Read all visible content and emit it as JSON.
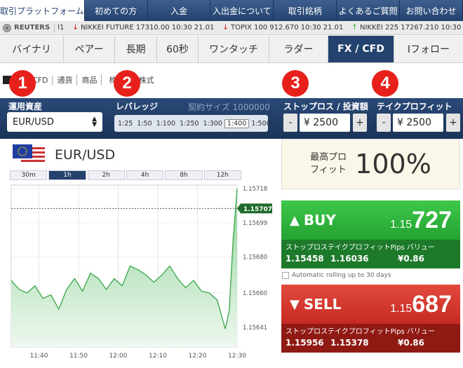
{
  "top_nav": [
    "取引プラットフォーム",
    "初めての方",
    "入金",
    "入出金について",
    "取引銘柄",
    "よくあるご質問",
    "お問い合わせ"
  ],
  "ticker": {
    "source": "REUTERS",
    "prefix": "l1",
    "items": [
      {
        "text": "NIKKEI FUTURE 17310.00 10:30 21.01",
        "dir": "down"
      },
      {
        "text": "TOPIX 100 912.670 10:30 21.01",
        "dir": "down"
      },
      {
        "text": "NIKKEI 225 17267.210 10:30",
        "dir": "up"
      }
    ]
  },
  "product_tabs": [
    "バイナリ",
    "ペアー",
    "長期",
    "60秒",
    "ワンタッチ",
    "ラダー",
    "FX / CFD",
    "Iフォロー"
  ],
  "sub_tabs": [
    "CFD",
    "通貨",
    "商品",
    "株",
    "株式"
  ],
  "badges": [
    "1",
    "2",
    "3",
    "4"
  ],
  "settings": {
    "asset_label": "運用資産",
    "asset_value": "EUR/USD",
    "leverage_label": "レバレッジ",
    "contract_label": "契約サイズ 1000000",
    "leverage_options": [
      "1:25",
      "1:50",
      "1:100",
      "1:250",
      "1:300",
      "1:400",
      "1:500"
    ],
    "leverage_selected": "1:400",
    "stoploss_label": "ストップロス / 投資額",
    "stoploss_value": "¥ 2500",
    "takeprofit_label": "テイクプロフィット",
    "takeprofit_value": "¥ 2500",
    "minus": "-",
    "plus": "+"
  },
  "chart_header": {
    "pair": "EUR/USD"
  },
  "timeframes": [
    "30m",
    "1h",
    "2h",
    "4h",
    "8h",
    "12h"
  ],
  "timeframe_active": "1h",
  "max_profit": {
    "label": "最高プロフィット",
    "value": "100%"
  },
  "buy": {
    "label": "BUY",
    "price_small": "1.15",
    "price_big": "727",
    "sub_labels": [
      "ストップロス",
      "テイクプロフィット",
      "Pips バリュー"
    ],
    "stoploss": "1.15458",
    "takeprofit": "1.16036",
    "pips": "¥0.86"
  },
  "sell": {
    "label": "SELL",
    "price_small": "1.15",
    "price_big": "687",
    "sub_labels": [
      "ストップロス",
      "テイクプロフィット",
      "Pips バリュー"
    ],
    "stoploss": "1.15956",
    "takeprofit": "1.15378",
    "pips": "¥0.86"
  },
  "rolling_label": "Automatic rolling up to 30 days",
  "colors": {
    "navy": "#24426e",
    "buy": "#2fae3a",
    "sell": "#d83a30",
    "badge": "#e8201c",
    "line": "#3aa64a"
  },
  "chart_data": {
    "type": "area",
    "x_ticks": [
      "11:40",
      "11:50",
      "12:00",
      "12:10",
      "12:20",
      "12:30"
    ],
    "y_ticks": [
      "1.15718",
      "1.15699",
      "1.15680",
      "1.15660",
      "1.15641"
    ],
    "current_price": "1.15707",
    "ylim": [
      1.1563,
      1.1572
    ],
    "x_minutes_start": "11:33",
    "x": [
      "11:33",
      "11:35",
      "11:37",
      "11:39",
      "11:41",
      "11:43",
      "11:45",
      "11:47",
      "11:49",
      "11:51",
      "11:53",
      "11:55",
      "11:57",
      "11:59",
      "12:01",
      "12:03",
      "12:05",
      "12:07",
      "12:09",
      "12:11",
      "12:13",
      "12:15",
      "12:17",
      "12:19",
      "12:21",
      "12:23",
      "12:25",
      "12:27",
      "12:28",
      "12:29",
      "12:30"
    ],
    "values": [
      1.15667,
      1.15662,
      1.1566,
      1.15664,
      1.15657,
      1.15659,
      1.15651,
      1.15662,
      1.15668,
      1.15661,
      1.15671,
      1.15668,
      1.15662,
      1.15668,
      1.15664,
      1.15675,
      1.15673,
      1.1567,
      1.15666,
      1.1567,
      1.15675,
      1.15668,
      1.15663,
      1.15667,
      1.15661,
      1.1566,
      1.15656,
      1.1564,
      1.1565,
      1.1569,
      1.15718
    ]
  }
}
